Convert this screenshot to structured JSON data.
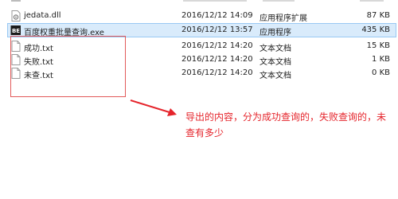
{
  "files": [
    {
      "name": "jedata.dll",
      "date": "2016/12/12 14:09",
      "type": "应用程序扩展",
      "size": "87 KB",
      "icon": "dll-file-icon",
      "selected": false
    },
    {
      "name": "百度权重批量查询.exe",
      "date": "2016/12/12 13:57",
      "type": "应用程序",
      "size": "435 KB",
      "icon": "exe-app-icon",
      "selected": true
    },
    {
      "name": "成功.txt",
      "date": "2016/12/12 14:20",
      "type": "文本文档",
      "size": "15 KB",
      "icon": "text-file-icon",
      "selected": false
    },
    {
      "name": "失败.txt",
      "date": "2016/12/12 14:20",
      "type": "文本文档",
      "size": "1 KB",
      "icon": "text-file-icon",
      "selected": false
    },
    {
      "name": "未查.txt",
      "date": "2016/12/12 14:20",
      "type": "文本文档",
      "size": "0 KB",
      "icon": "text-file-icon",
      "selected": false
    }
  ],
  "exe_icon_text": "BE",
  "annotation": {
    "text": "导出的内容，分为成功查询的，失败查询的，未查有多少",
    "color": "#e5242b"
  }
}
